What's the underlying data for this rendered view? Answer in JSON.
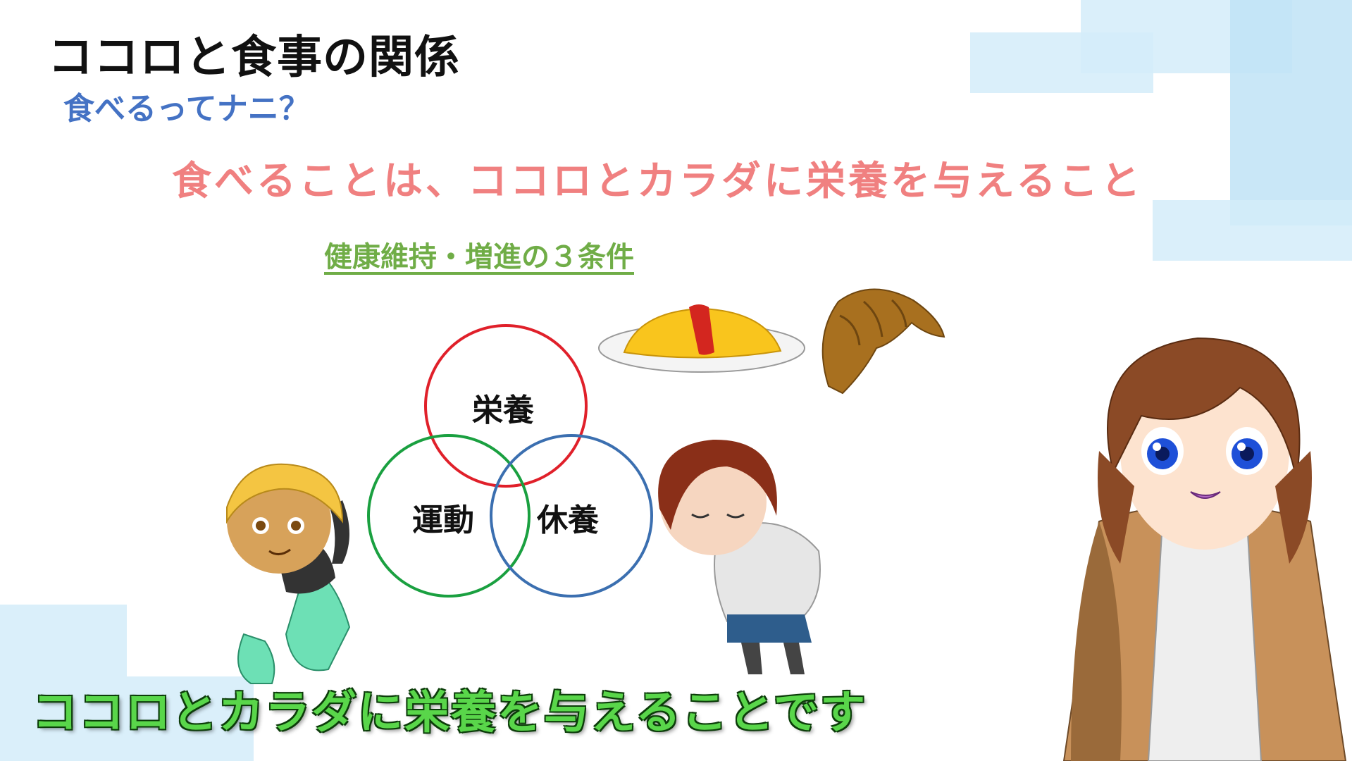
{
  "slide": {
    "title": "ココロと食事の関係",
    "subtitle": "食べるってナニ？",
    "headline": "食べることは、ココロとカラダに栄養を与えること",
    "conditions_heading": "健康維持・増進の３条件"
  },
  "venn": {
    "top_label": "栄養",
    "left_label": "運動",
    "right_label": "休養",
    "colors": {
      "top": "#e0202a",
      "left": "#1aa040",
      "right": "#3b6fb0"
    }
  },
  "caption": "ココロとカラダに栄養を与えることです",
  "colors": {
    "title": "#111111",
    "subtitle": "#4472c4",
    "headline": "#f08080",
    "conditions": "#70ad47",
    "caption": "#59d64a",
    "decoration": "#d4ecf9"
  },
  "illustrations": [
    "omelette-rice-icon",
    "croissant-icon",
    "blond-boy-stretching",
    "sleeping-girl",
    "narrator-girl-avatar"
  ]
}
